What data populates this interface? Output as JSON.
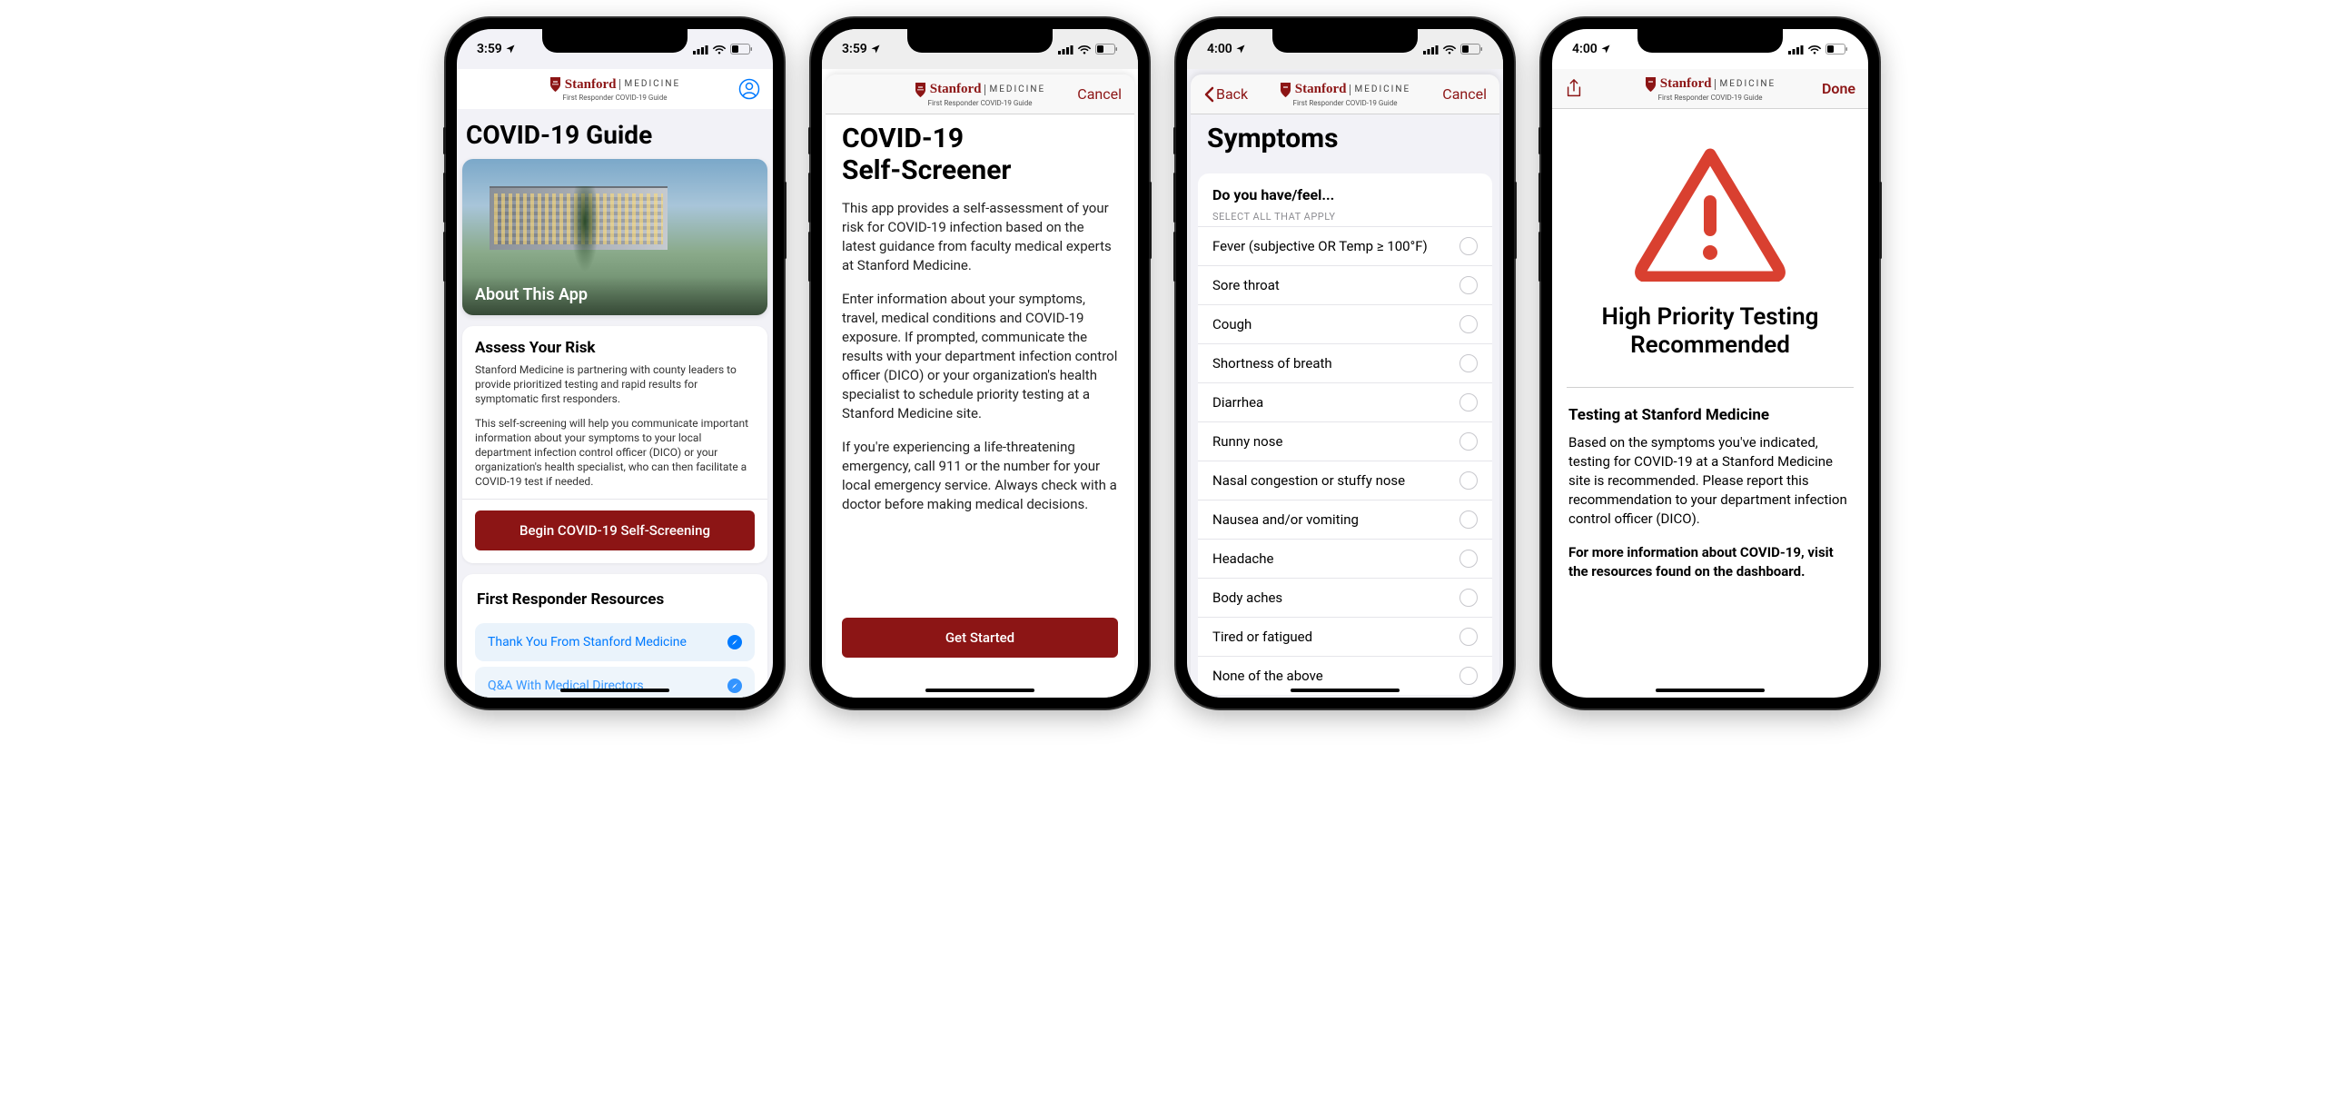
{
  "brand": {
    "name": "Stanford",
    "division": "MEDICINE",
    "subtitle": "First Responder COVID-19 Guide"
  },
  "screen1": {
    "time": "3:59",
    "title": "COVID-19 Guide",
    "hero_overlay": "About This App",
    "assess_title": "Assess Your Risk",
    "assess_p1": "Stanford Medicine is partnering with county leaders to provide prioritized testing and rapid results for symptomatic first responders.",
    "assess_p2": "This self-screening will help you communicate important information about your symptoms to your local department infection control officer (DICO) or your organization's health specialist, who can then facilitate a COVID-19 test if needed.",
    "begin_btn": "Begin COVID-19 Self-Screening",
    "resources_title": "First Responder Resources",
    "resources": [
      "Thank You From Stanford Medicine",
      "Q&A With Medical Directors"
    ]
  },
  "screen2": {
    "time": "3:59",
    "cancel": "Cancel",
    "title_line1": "COVID-19",
    "title_line2": "Self-Screener",
    "p1": "This app provides a self-assessment of your risk for COVID-19 infection based on the latest guidance from faculty medical experts at Stanford Medicine.",
    "p2": "Enter information about your symptoms, travel, medical conditions and COVID-19 exposure. If prompted, communicate the results with your department infection control officer (DICO) or your organization's health specialist to schedule priority testing at a Stanford Medicine site.",
    "p3": "If you're experiencing a life-threatening emergency, call 911 or the number for your local emergency service.  Always check with a doctor before making medical decisions.",
    "get_started": "Get Started"
  },
  "screen3": {
    "time": "4:00",
    "back": "Back",
    "cancel": "Cancel",
    "title": "Symptoms",
    "prompt": "Do you have/feel...",
    "hint": "SELECT ALL THAT APPLY",
    "items": [
      "Fever (subjective OR Temp ≥ 100°F)",
      "Sore throat",
      "Cough",
      "Shortness of breath",
      "Diarrhea",
      "Runny nose",
      "Nasal congestion or stuffy nose",
      "Nausea and/or vomiting",
      "Headache",
      "Body aches",
      "Tired or fatigued",
      "None of the above"
    ]
  },
  "screen4": {
    "time": "4:00",
    "done": "Done",
    "result_title": "High Priority Testing Recommended",
    "sub": "Testing at Stanford Medicine",
    "p1": "Based on the symptoms you've indicated, testing for COVID-19 at a Stanford Medicine site is recommended. Please report this recommendation to your department infection control officer (DICO).",
    "p2": "For more information about COVID-19, visit the resources found on the dashboard."
  }
}
